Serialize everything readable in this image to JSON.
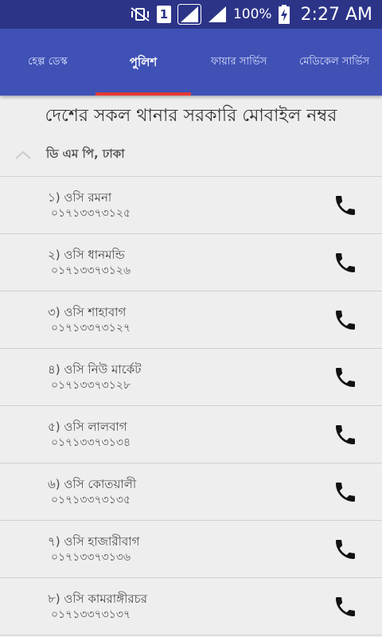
{
  "status_bar": {
    "sim_label": "1",
    "battery_percent": "100%",
    "time": "2:27 AM"
  },
  "tabs": [
    {
      "label": "হেল্প ডেস্ক",
      "active": false
    },
    {
      "label": "পুলিশ",
      "active": true
    },
    {
      "label": "ফায়ার সার্ভিস",
      "active": false
    },
    {
      "label": "মেডিকেল সার্ভিস",
      "active": false
    }
  ],
  "heading": "দেশের সকল থানার সরকারি মোবাইল নম্বর",
  "section": {
    "title": "ডি এম পি, ঢাকা",
    "expanded": true
  },
  "contacts": [
    {
      "name": "১) ওসি রমনা",
      "number": "০১৭১৩৩৭৩১২৫"
    },
    {
      "name": "২) ওসি ধানমন্ডি",
      "number": "০১৭১৩৩৭৩১২৬"
    },
    {
      "name": "৩) ওসি শাহাবাগ",
      "number": "০১৭১৩৩৭৩১২৭"
    },
    {
      "name": "৪) ওসি নিউ মার্কেট",
      "number": "০১৭১৩৩৭৩১২৮"
    },
    {
      "name": "৫) ওসি লালবাগ",
      "number": "০১৭১৩৩৭৩১৩৪"
    },
    {
      "name": "৬) ওসি কোতয়ালী",
      "number": "০১৭১৩৩৭৩১৩৫"
    },
    {
      "name": "৭) ওসি হাজারীবাগ",
      "number": "০১৭১৩৩৭৩১৩৬"
    },
    {
      "name": "৮) ওসি কামরাঙ্গীরচর",
      "number": "০১৭১৩৩৭৩১৩৭"
    }
  ],
  "icons": {
    "call": "phone-icon",
    "collapse": "chevron-up-icon"
  },
  "colors": {
    "status_bar": "#2c3488",
    "toolbar": "#3f51b5",
    "tab_indicator": "#e53935",
    "background": "#eeeeee"
  }
}
